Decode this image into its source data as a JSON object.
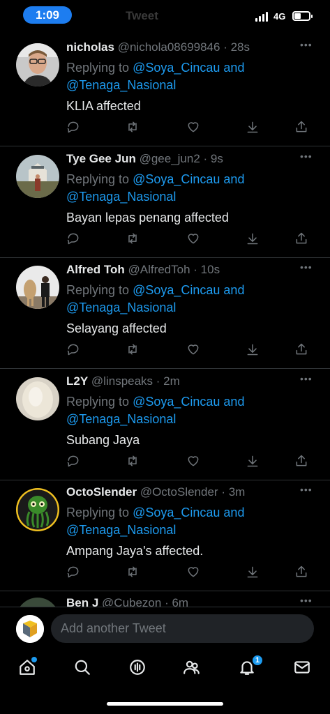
{
  "status_bar": {
    "time": "1:09",
    "network": "4G",
    "faded_title": "Tweet"
  },
  "reply_prefix": "Replying to",
  "tweets": [
    {
      "name": "nicholas",
      "handle": "@nichola08699846",
      "time": "· 28s",
      "mention_1": "@Soya_Cincau and",
      "mention_2": "@Tenaga_Nasional",
      "text": "KLIA affected"
    },
    {
      "name": "Tye Gee Jun",
      "handle": "@gee_jun2",
      "time": "· 9s",
      "mention_1": "@Soya_Cincau and",
      "mention_2": "@Tenaga_Nasional",
      "text": "Bayan lepas penang affected"
    },
    {
      "name": "Alfred Toh",
      "handle": "@AlfredToh",
      "time": "· 10s",
      "mention_1": "@Soya_Cincau and",
      "mention_2": "@Tenaga_Nasional",
      "text": "Selayang affected"
    },
    {
      "name": "L2Y",
      "handle": "@linspeaks",
      "time": "· 2m",
      "mention_1": "@Soya_Cincau and",
      "mention_2": "@Tenaga_Nasional",
      "text": "Subang Jaya"
    },
    {
      "name": "OctoSlender",
      "handle": "@OctoSlender",
      "time": "· 3m",
      "mention_1": "@Soya_Cincau and",
      "mention_2": "@Tenaga_Nasional",
      "text": "Ampang Jaya's affected."
    }
  ],
  "partial_tweet": {
    "name": "Ben J",
    "handle": "@Cubezon",
    "time": "· 6m"
  },
  "compose": {
    "placeholder": "Add another Tweet"
  },
  "tabbar": {
    "notification_count": "1",
    "icons": [
      "home-icon",
      "search-icon",
      "spaces-icon",
      "communities-icon",
      "bell-icon",
      "mail-icon"
    ]
  },
  "colors": {
    "accent": "#1d9bf0",
    "background": "#000000",
    "muted": "#71767b"
  }
}
